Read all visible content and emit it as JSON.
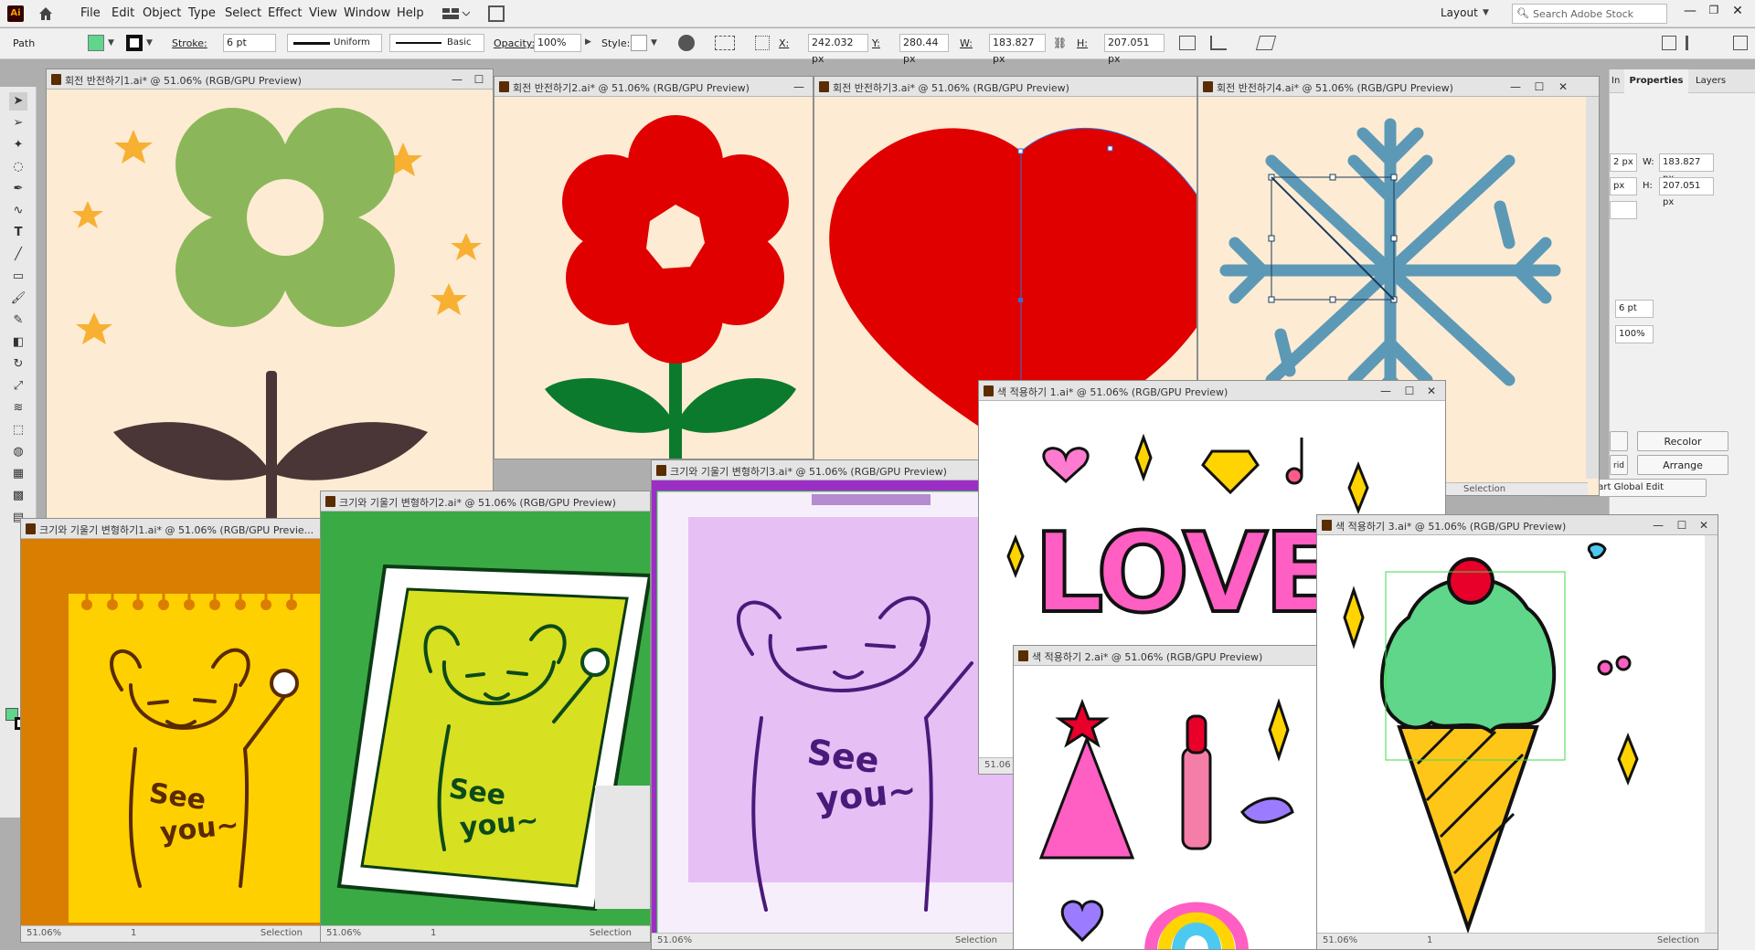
{
  "app": {
    "logo": "Ai",
    "home_icon": "home-icon"
  },
  "menu": [
    "File",
    "Edit",
    "Object",
    "Type",
    "Select",
    "Effect",
    "View",
    "Window",
    "Help"
  ],
  "workspace": {
    "label": "Layout",
    "search_placeholder": "Search Adobe Stock"
  },
  "control": {
    "selection_type": "Path",
    "stroke_label": "Stroke:",
    "stroke_value": "6 pt",
    "profile": "Uniform",
    "brush": "Basic",
    "opacity_label": "Opacity:",
    "opacity_value": "100%",
    "style_label": "Style:",
    "x_label": "X:",
    "x_value": "242.032 px",
    "y_label": "Y:",
    "y_value": "280.44 px",
    "w_label": "W:",
    "w_value": "183.827 px",
    "h_label": "H:",
    "h_value": "207.051 px"
  },
  "panel": {
    "tab_in": "In",
    "tab_properties": "Properties",
    "tab_layers": "Layers",
    "x_value": "2 px",
    "y_value": "px",
    "w_label": "W:",
    "w_value": "183.827 px",
    "h_label": "H:",
    "h_value": "207.051 px",
    "stroke_value": "6 pt",
    "opacity_value": "100%",
    "recolor": "Recolor",
    "arrange": "Arrange",
    "grid_label": "rid",
    "global_edit": "Start Global Edit",
    "selection_label": "Selection"
  },
  "windows": [
    {
      "title": "회전 반전하기1.ai* @ 51.06% (RGB/GPU Preview)",
      "bg": "#fdebd3"
    },
    {
      "title": "회전 반전하기2.ai* @ 51.06% (RGB/GPU Preview)",
      "bg": "#fdebd3"
    },
    {
      "title": "회전 반전하기3.ai* @ 51.06% (RGB/GPU Preview)",
      "bg": "#fdebd3"
    },
    {
      "title": "회전 반전하기4.ai* @ 51.06% (RGB/GPU Preview)",
      "bg": "#fdebd3"
    },
    {
      "title": "크기와 기울기 변형하기1.ai* @ 51.06% (RGB/GPU Previe...",
      "bg": "#d97e00",
      "zoom": "51.06%",
      "page": "1",
      "tool": "Selection"
    },
    {
      "title": "크기와 기울기 변형하기2.ai* @ 51.06% (RGB/GPU Preview)",
      "bg": "#3aaa45",
      "zoom": "51.06%",
      "page": "1",
      "tool": "Selection"
    },
    {
      "title": "크기와 기울기 변형하기3.ai* @ 51.06% (RGB/GPU Preview)",
      "bg": "#9b2ec4",
      "zoom": "51.06%",
      "tool": "Selection"
    },
    {
      "title": "색 적용하기 1.ai* @ 51.06% (RGB/GPU Preview)",
      "bg": "#ffffff",
      "zoom": "51.06"
    },
    {
      "title": "색 적용하기 2.ai* @ 51.06% (RGB/GPU Preview)",
      "bg": "#ffffff"
    },
    {
      "title": "색 적용하기 3.ai* @ 51.06% (RGB/GPU Preview)",
      "bg": "#ffffff",
      "zoom": "51.06%",
      "page": "1",
      "tool": "Selection"
    }
  ],
  "art": {
    "see": "See",
    "you": "you~",
    "love": "LOVE"
  },
  "colors": {
    "selection": "#2f6fd6",
    "green_sel": "#3ddc4a"
  }
}
